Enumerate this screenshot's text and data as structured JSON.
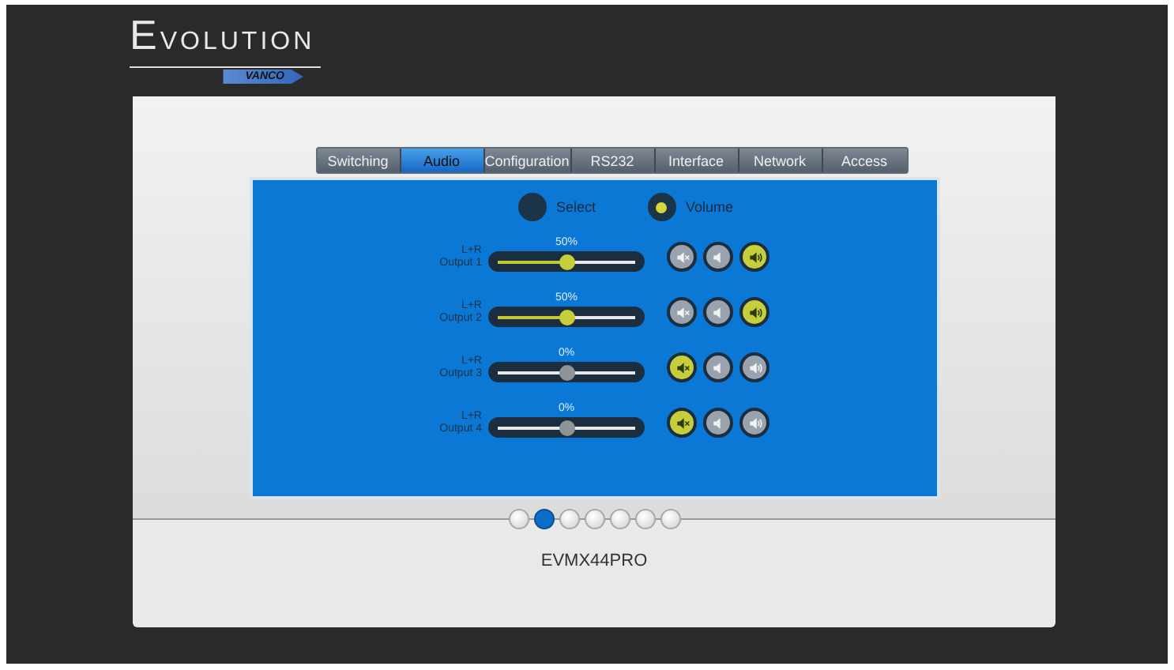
{
  "logo": {
    "title": "EVOLUTION",
    "badge": "VANCO"
  },
  "tabs": [
    {
      "label": "Switching",
      "selected": false
    },
    {
      "label": "Audio",
      "selected": true
    },
    {
      "label": "Configuration",
      "selected": false
    },
    {
      "label": "RS232",
      "selected": false
    },
    {
      "label": "Interface",
      "selected": false
    },
    {
      "label": "Network",
      "selected": false
    },
    {
      "label": "Access",
      "selected": false
    }
  ],
  "modes": [
    {
      "label": "Select",
      "selected": false
    },
    {
      "label": "Volume",
      "selected": true
    }
  ],
  "outputs": [
    {
      "channel": "L+R",
      "name": "Output 1",
      "reading": "50%",
      "level": 0.5,
      "muted": false
    },
    {
      "channel": "L+R",
      "name": "Output 2",
      "reading": "50%",
      "level": 0.5,
      "muted": false
    },
    {
      "channel": "L+R",
      "name": "Output 3",
      "reading": "0%",
      "level": 0.5,
      "muted": true
    },
    {
      "channel": "L+R",
      "name": "Output 4",
      "reading": "0%",
      "level": 0.5,
      "muted": true
    }
  ],
  "pages": [
    {
      "selected": false
    },
    {
      "selected": true
    },
    {
      "selected": false
    },
    {
      "selected": false
    },
    {
      "selected": false
    },
    {
      "selected": false
    },
    {
      "selected": false
    }
  ],
  "model": "EVMX44PRO"
}
